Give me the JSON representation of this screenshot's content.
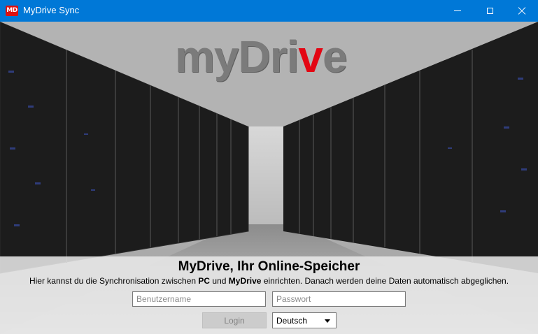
{
  "titlebar": {
    "app_icon_text": "MD",
    "title": "MyDrive Sync",
    "icons": [
      "minimize-icon",
      "maximize-icon",
      "close-icon"
    ]
  },
  "hero": {
    "logo": {
      "prefix": "myDri",
      "accent": "v",
      "suffix": "e"
    },
    "image": "server-room-photo"
  },
  "panel": {
    "headline": "MyDrive, Ihr Online-Speicher",
    "description": {
      "part1": "Hier kannst du die Synchronisation zwischen ",
      "bold1": "PC",
      "part2": " und ",
      "bold2": "MyDrive",
      "part3": " einrichten. Danach werden deine Daten automatisch abgeglichen."
    },
    "username": {
      "value": "",
      "placeholder": "Benutzername"
    },
    "password": {
      "value": "",
      "placeholder": "Passwort"
    },
    "login_label": "Login",
    "language": {
      "selected": "Deutsch"
    }
  },
  "colors": {
    "titlebar": "#0078d7",
    "accent": "#e30613",
    "logo_gray": "#7b7b7b"
  }
}
